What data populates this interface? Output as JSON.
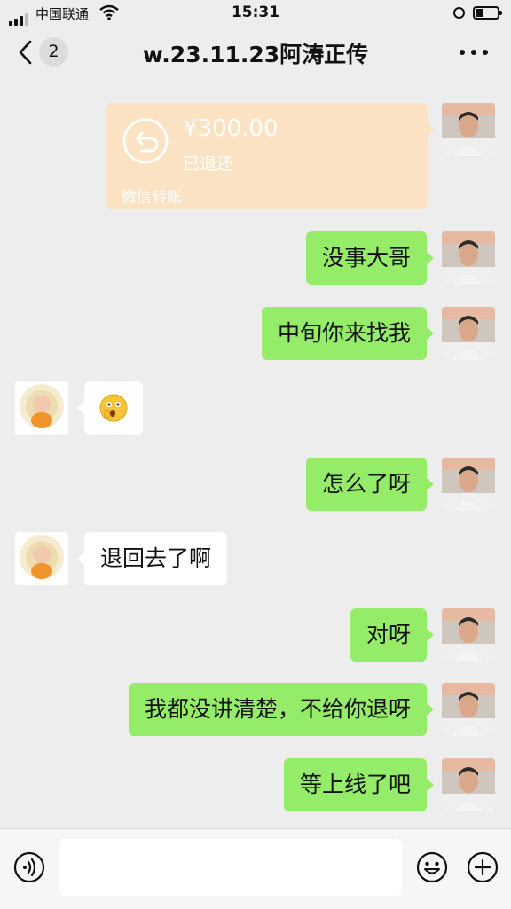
{
  "status_bar": {
    "carrier": "中国联通",
    "time": "15:31"
  },
  "nav": {
    "back_icon": "chevron-left-icon",
    "unread_count": "2",
    "title": "w.23.11.23阿涛正传",
    "more_icon": "more-dots-icon"
  },
  "messages": [
    {
      "sender": "me",
      "type": "transfer",
      "amount": "¥300.00",
      "status": "已退还",
      "source": "微信转账",
      "icon": "refund-icon"
    },
    {
      "sender": "me",
      "type": "text",
      "text": "没事大哥"
    },
    {
      "sender": "me",
      "type": "text",
      "text": "中旬你来找我"
    },
    {
      "sender": "other",
      "type": "emoji",
      "icon": "surprised-face-emoji"
    },
    {
      "sender": "me",
      "type": "text",
      "text": "怎么了呀"
    },
    {
      "sender": "other",
      "type": "text",
      "text": "退回去了啊"
    },
    {
      "sender": "me",
      "type": "text",
      "text": "对呀"
    },
    {
      "sender": "me",
      "type": "text",
      "text": "我都没讲清楚，不给你退呀"
    },
    {
      "sender": "me",
      "type": "text",
      "text": "等上线了吧"
    }
  ],
  "input_bar": {
    "voice_icon": "voice-icon",
    "input_value": "",
    "emoji_icon": "smiley-icon",
    "plus_icon": "plus-icon"
  },
  "colors": {
    "background": "#ededed",
    "my_bubble": "#95ec69",
    "their_bubble": "#ffffff",
    "transfer_card": "#fbe2c3"
  }
}
